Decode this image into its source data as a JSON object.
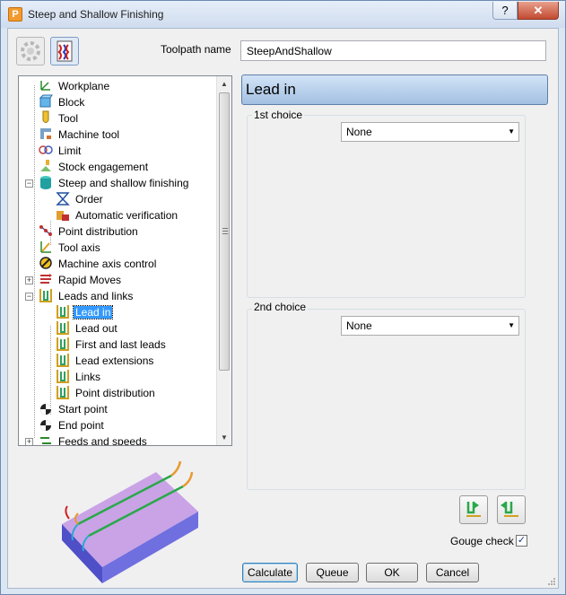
{
  "window": {
    "title": "Steep and Shallow Finishing",
    "help_label": "?",
    "close_label": "✕"
  },
  "toolpath": {
    "label": "Toolpath name",
    "value": "SteepAndShallow"
  },
  "tree": {
    "items": [
      {
        "label": "Workplane",
        "icon": "workplane-icon"
      },
      {
        "label": "Block",
        "icon": "block-icon"
      },
      {
        "label": "Tool",
        "icon": "tool-icon"
      },
      {
        "label": "Machine tool",
        "icon": "machine-tool-icon"
      },
      {
        "label": "Limit",
        "icon": "limit-icon"
      },
      {
        "label": "Stock engagement",
        "icon": "stock-engagement-icon"
      },
      {
        "label": "Steep and shallow finishing",
        "icon": "steep-shallow-icon"
      },
      {
        "label": "Order",
        "icon": "order-icon"
      },
      {
        "label": "Automatic verification",
        "icon": "verification-icon"
      },
      {
        "label": "Point distribution",
        "icon": "point-distribution-icon"
      },
      {
        "label": "Tool axis",
        "icon": "tool-axis-icon"
      },
      {
        "label": "Machine axis control",
        "icon": "machine-axis-icon"
      },
      {
        "label": "Rapid Moves",
        "icon": "rapid-moves-icon"
      },
      {
        "label": "Leads and links",
        "icon": "leads-links-icon"
      },
      {
        "label": "Lead in",
        "icon": "lead-in-icon"
      },
      {
        "label": "Lead out",
        "icon": "lead-out-icon"
      },
      {
        "label": "First and last leads",
        "icon": "first-last-leads-icon"
      },
      {
        "label": "Lead extensions",
        "icon": "lead-extensions-icon"
      },
      {
        "label": "Links",
        "icon": "links-icon"
      },
      {
        "label": "Point distribution",
        "icon": "point-distribution-icon"
      },
      {
        "label": "Start point",
        "icon": "start-point-icon"
      },
      {
        "label": "End point",
        "icon": "end-point-icon"
      },
      {
        "label": "Feeds and speeds",
        "icon": "feeds-speeds-icon"
      }
    ],
    "selected": "Lead in"
  },
  "panel": {
    "header": "Lead in",
    "first_choice": {
      "label": "1st choice",
      "value": "None"
    },
    "second_choice": {
      "label": "2nd choice",
      "value": "None"
    }
  },
  "gouge_check": {
    "label": "Gouge check",
    "checked": true,
    "mark": "✓"
  },
  "buttons": {
    "calculate": "Calculate",
    "queue": "Queue",
    "ok": "OK",
    "cancel": "Cancel"
  },
  "colors": {
    "accent_header": "#a3c0e2",
    "selection": "#3399ff",
    "block_top": "#c9a3e6",
    "block_side": "#6f6fe0"
  }
}
